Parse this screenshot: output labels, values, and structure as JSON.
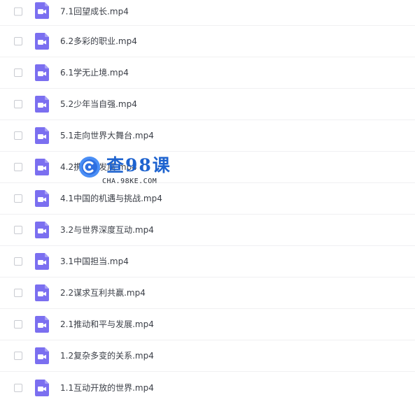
{
  "files": [
    {
      "name": "7.1回望成长.mp4",
      "icon": "video-file-icon"
    },
    {
      "name": "6.2多彩的职业.mp4",
      "icon": "video-file-icon"
    },
    {
      "name": "6.1学无止境.mp4",
      "icon": "video-file-icon"
    },
    {
      "name": "5.2少年当自强.mp4",
      "icon": "video-file-icon"
    },
    {
      "name": "5.1走向世界大舞台.mp4",
      "icon": "video-file-icon"
    },
    {
      "name": "4.2携手促发展.mp4",
      "icon": "video-file-icon"
    },
    {
      "name": "4.1中国的机遇与挑战.mp4",
      "icon": "video-file-icon"
    },
    {
      "name": "3.2与世界深度互动.mp4",
      "icon": "video-file-icon"
    },
    {
      "name": "3.1中国担当.mp4",
      "icon": "video-file-icon"
    },
    {
      "name": "2.2谋求互利共赢.mp4",
      "icon": "video-file-icon"
    },
    {
      "name": "2.1推动和平与发展.mp4",
      "icon": "video-file-icon"
    },
    {
      "name": "1.2复杂多变的关系.mp4",
      "icon": "video-file-icon"
    },
    {
      "name": "1.1互动开放的世界.mp4",
      "icon": "video-file-icon"
    }
  ],
  "watermark": {
    "title": "查98课",
    "url": "CHA.98KE.COM",
    "logo_icon": "cha98ke-logo-icon"
  },
  "colors": {
    "icon": "#7b6ff0",
    "text": "#3b3f47",
    "divider": "#f0f0f2",
    "watermark": "#1e63cf"
  }
}
